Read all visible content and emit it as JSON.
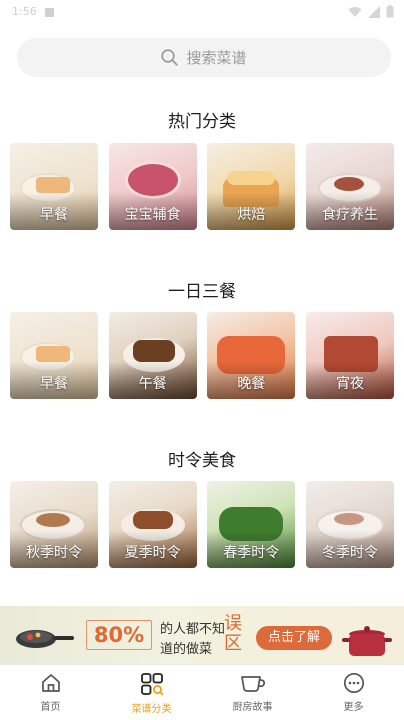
{
  "status_bar": {
    "time": "1:56"
  },
  "search": {
    "placeholder": "搜索菜谱"
  },
  "sections": [
    {
      "title": "热门分类",
      "items": [
        "早餐",
        "宝宝辅食",
        "烘焙",
        "食疗养生"
      ]
    },
    {
      "title": "一日三餐",
      "items": [
        "早餐",
        "午餐",
        "晚餐",
        "宵夜"
      ]
    },
    {
      "title": "时令美食",
      "items": [
        "秋季时令",
        "夏季时令",
        "春季时令",
        "冬季时令"
      ]
    }
  ],
  "banner": {
    "percent": "80%",
    "line1": "的人都不知",
    "line2": "道的做菜",
    "emphasis": "误区",
    "button": "点击了解"
  },
  "tabbar": {
    "items": [
      {
        "label": "首页",
        "icon": "home-icon",
        "active": false
      },
      {
        "label": "菜谱分类",
        "icon": "category-icon",
        "active": true
      },
      {
        "label": "厨房故事",
        "icon": "cup-icon",
        "active": false
      },
      {
        "label": "更多",
        "icon": "more-icon",
        "active": false
      }
    ],
    "active_color": "#f0a11a",
    "inactive_color": "#666666"
  }
}
